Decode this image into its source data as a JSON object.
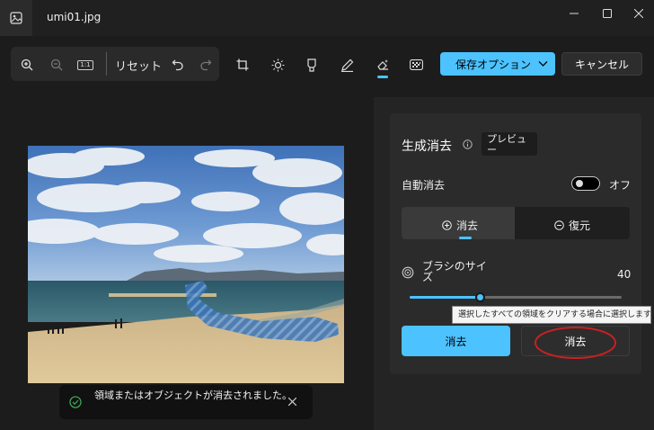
{
  "window": {
    "title": "umi01.jpg",
    "icon": "photo-icon",
    "controls": [
      "minimize-icon",
      "maximize-icon",
      "close-icon"
    ]
  },
  "toolbar": {
    "zoom_in_icon": "zoom-in-icon",
    "zoom_out_icon": "zoom-out-icon",
    "actual_size_label": "1:1",
    "reset_label": "リセット",
    "tools": [
      "crop-icon",
      "brightness-icon",
      "markup-icon",
      "pen-icon",
      "generative-erase-icon",
      "filter-icon"
    ],
    "active_tool": "generative-erase-icon",
    "save_options_label": "保存オプション",
    "cancel_label": "キャンセル",
    "accent_color": "#4cc2ff"
  },
  "toast": {
    "message": "領域またはオブジェクトが消去されました。",
    "status_color": "#3aa655"
  },
  "panel": {
    "title": "生成消去",
    "preview_badge": "プレビュー",
    "auto_erase_label": "自動消去",
    "auto_erase_state": "オフ",
    "auto_erase_on": false,
    "mode_erase": "消去",
    "mode_restore": "復元",
    "active_mode": "erase",
    "brush_size_label": "ブラシのサイズ",
    "brush_size_value": "40",
    "brush_slider_fraction": 0.33,
    "tooltip": "選択したすべての領域をクリアする場合に選択します。",
    "erase_button": "消去",
    "erase_all_button": "消去",
    "highlight_color": "#c82020"
  }
}
